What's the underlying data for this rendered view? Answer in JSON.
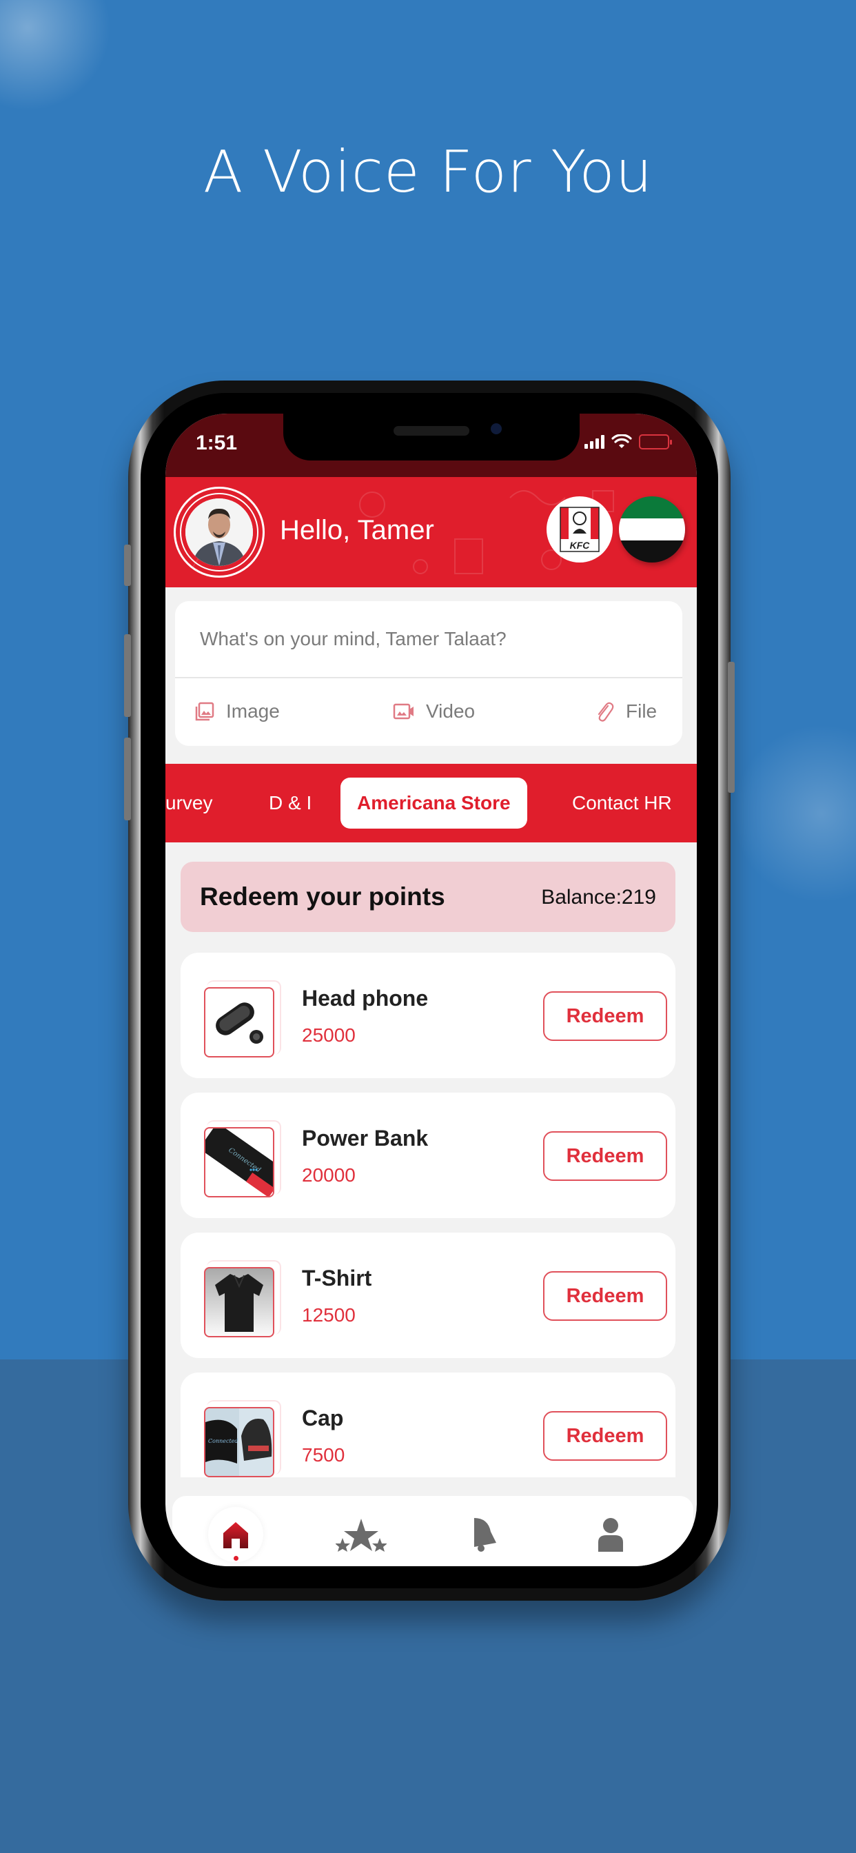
{
  "promo": {
    "headline": "A Voice For You"
  },
  "statusbar": {
    "time": "1:51"
  },
  "header": {
    "greeting": "Hello, Tamer",
    "brand_logo": "KFC",
    "flag": "UAE"
  },
  "composer": {
    "placeholder": "What's on your mind, Tamer Talaat?",
    "actions": [
      {
        "label": "Image",
        "icon": "image-icon"
      },
      {
        "label": "Video",
        "icon": "video-icon"
      },
      {
        "label": "File",
        "icon": "paperclip-icon"
      }
    ]
  },
  "tabs": [
    {
      "label": "urvey",
      "active": false
    },
    {
      "label": "D & I",
      "active": false
    },
    {
      "label": "Americana Store",
      "active": true
    },
    {
      "label": "Contact HR",
      "active": false
    }
  ],
  "store": {
    "title": "Redeem your points",
    "balance": "Balance:219",
    "redeem_label": "Redeem",
    "products": [
      {
        "name": "Head phone",
        "points": "25000",
        "image": "earbuds"
      },
      {
        "name": "Power Bank",
        "points": "20000",
        "image": "power-bank"
      },
      {
        "name": "T-Shirt",
        "points": "12500",
        "image": "polo-shirt"
      },
      {
        "name": "Cap",
        "points": "7500",
        "image": "cap"
      }
    ]
  },
  "bottom_nav": [
    {
      "name": "home",
      "active": true
    },
    {
      "name": "rewards",
      "active": false
    },
    {
      "name": "notifications",
      "active": false
    },
    {
      "name": "profile",
      "active": false
    }
  ],
  "colors": {
    "brand_red": "#e01e2c",
    "background_blue": "#327bbd",
    "banner_pink": "#f1ced3"
  }
}
